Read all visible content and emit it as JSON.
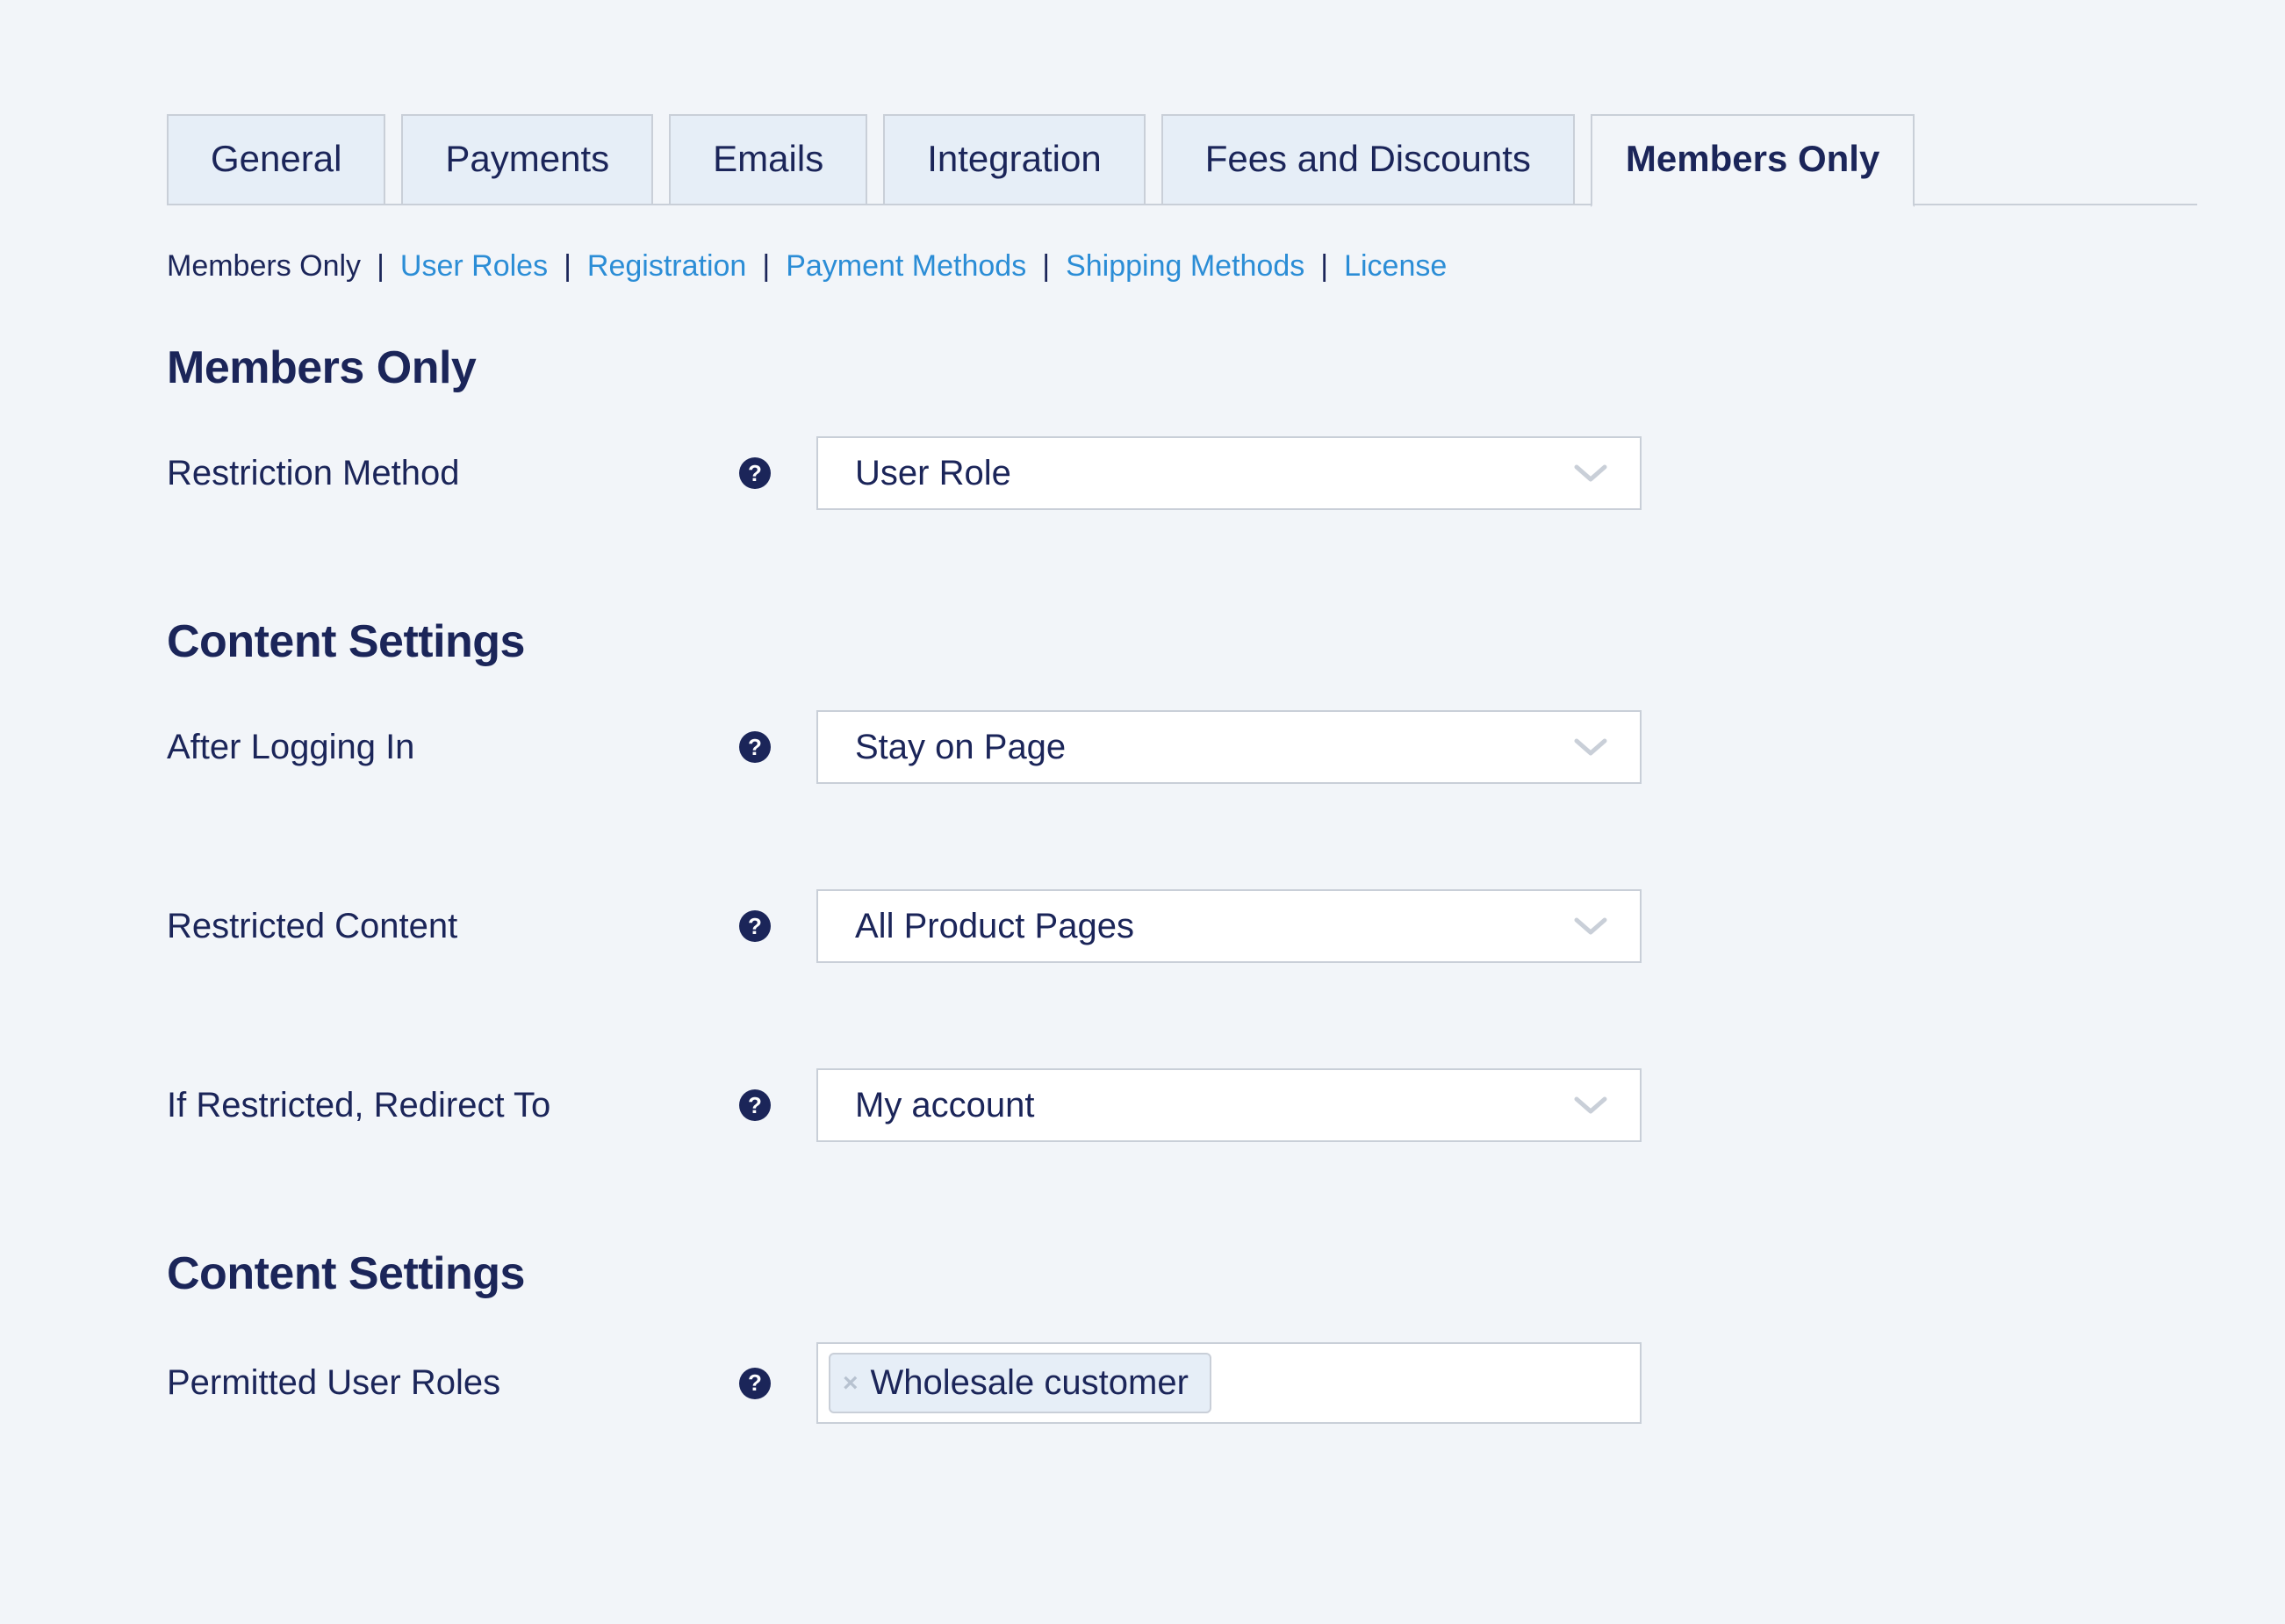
{
  "tabs": [
    {
      "label": "General"
    },
    {
      "label": "Payments"
    },
    {
      "label": "Emails"
    },
    {
      "label": "Integration"
    },
    {
      "label": "Fees and Discounts"
    },
    {
      "label": "Members Only"
    }
  ],
  "subnav": [
    {
      "label": "Members Only",
      "current": true
    },
    {
      "label": "User Roles"
    },
    {
      "label": "Registration"
    },
    {
      "label": "Payment Methods"
    },
    {
      "label": "Shipping Methods"
    },
    {
      "label": "License"
    }
  ],
  "sections": {
    "members_only": {
      "title": "Members Only",
      "restriction_method": {
        "label": "Restriction Method",
        "value": "User Role"
      }
    },
    "content_settings": {
      "title": "Content Settings",
      "after_login": {
        "label": "After Logging In",
        "value": "Stay on Page"
      },
      "restricted": {
        "label": "Restricted Content",
        "value": "All Product Pages"
      },
      "redirect": {
        "label": "If Restricted, Redirect To",
        "value": "My account"
      }
    },
    "content_settings_2": {
      "title": "Content Settings",
      "permitted_roles": {
        "label": "Permitted User Roles",
        "tags": [
          "Wholesale customer"
        ]
      }
    }
  },
  "icons": {
    "help": "?"
  }
}
